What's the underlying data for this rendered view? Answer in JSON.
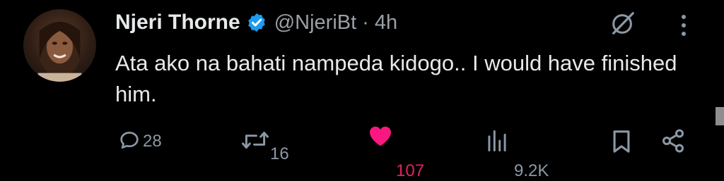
{
  "tweet": {
    "author_name": "Njeri Thorne",
    "handle": "@NjeriBt",
    "separator": "·",
    "time": "4h",
    "text": "Ata ako na bahati nampeda kidogo.. I would have finished him."
  },
  "actions": {
    "replies": "28",
    "reposts": "16",
    "likes": "107",
    "views": "9.2K"
  },
  "icons": {
    "verified": "verified-badge-icon",
    "grok": "grok-icon",
    "more": "more-vertical-icon",
    "reply": "reply-icon",
    "repost": "repost-icon",
    "like": "heart-icon",
    "views": "views-icon",
    "bookmark": "bookmark-icon",
    "share": "share-icon"
  },
  "colors": {
    "background": "#000000",
    "text": "#e7e9ea",
    "muted": "#8b98a5",
    "verified": "#1d9bf0",
    "like": "#f91880"
  }
}
